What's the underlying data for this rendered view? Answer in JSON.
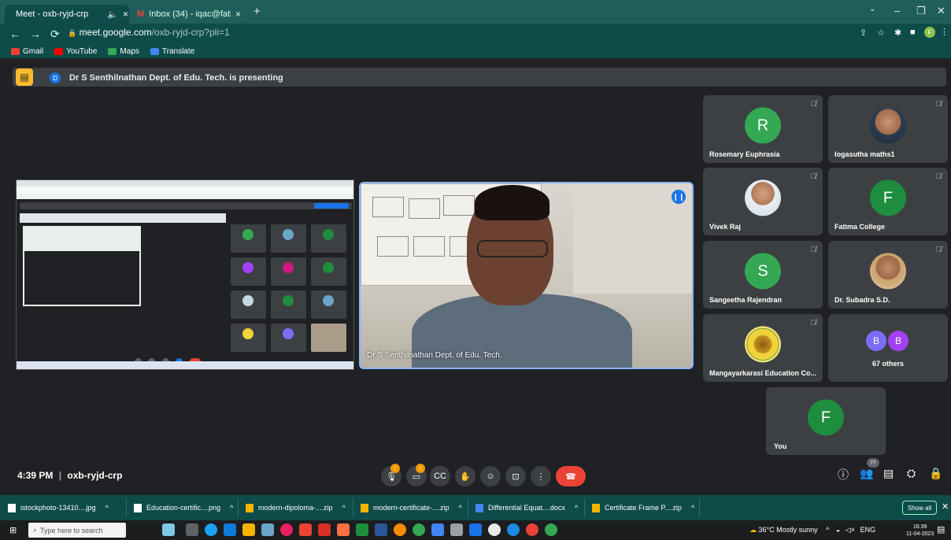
{
  "browser": {
    "tabs": [
      {
        "label": "Meet - oxb-ryjd-crp",
        "active": true
      },
      {
        "label": "Inbox (34) - iqac@fatimacollege",
        "active": false
      }
    ],
    "new_tab": "+",
    "url_host": "meet.google.com",
    "url_path": "/oxb-ryjd-crp?pli=1",
    "profile_initial": "F",
    "bookmarks": [
      "Gmail",
      "YouTube",
      "Maps",
      "Translate"
    ]
  },
  "meet": {
    "presenter_initial": "D",
    "presenting_text": "Dr S Senthilnathan Dept. of Edu. Tech. is presenting",
    "speaker_name": "Dr S Senthilnathan Dept. of Edu. Tech.",
    "participants": [
      {
        "name": "Rosemary Euphrasia",
        "initial": "R",
        "color": "#34a853"
      },
      {
        "name": "logasutha maths1",
        "initial": "",
        "color": "#6aa5c8"
      },
      {
        "name": "Vivek Raj",
        "initial": "",
        "color": "#c7d7e0"
      },
      {
        "name": "Fatima College",
        "initial": "F",
        "color": "#1e8e3e"
      },
      {
        "name": "Sangeetha Rajendran",
        "initial": "S",
        "color": "#34a853"
      },
      {
        "name": "Dr. Subadra S.D.",
        "initial": "",
        "color": "#e0c7a6"
      },
      {
        "name": "Mangayarkarasi Education Co...",
        "initial": "",
        "color": "#f2d23a"
      },
      {
        "name": "67 others",
        "initial": "B",
        "color": "#7b6ef6"
      }
    ],
    "self_tile": {
      "name": "You",
      "initial": "F",
      "color": "#1e8e3e"
    },
    "time": "4:39 PM",
    "separator": "|",
    "meeting_code": "oxb-ryjd-crp",
    "people_count": "77"
  },
  "downloads": [
    {
      "name": "istockphoto-13410....jpg",
      "color": "#ffffff"
    },
    {
      "name": "Education-certific....png",
      "color": "#ffffff"
    },
    {
      "name": "modern-dipoloma-....zip",
      "color": "#f4b400"
    },
    {
      "name": "modern-certificate-....zip",
      "color": "#f4b400"
    },
    {
      "name": "Differential Equat....docx",
      "color": "#4285f4"
    },
    {
      "name": "Certificate Frame P....zip",
      "color": "#f4b400"
    }
  ],
  "downloads_show_all": "Show all",
  "taskbar": {
    "search_placeholder": "Type here to search",
    "weather": "36°C Mostly sunny",
    "lang": "ENG",
    "clock_time": "16:39",
    "clock_date": "11-04-2023"
  }
}
